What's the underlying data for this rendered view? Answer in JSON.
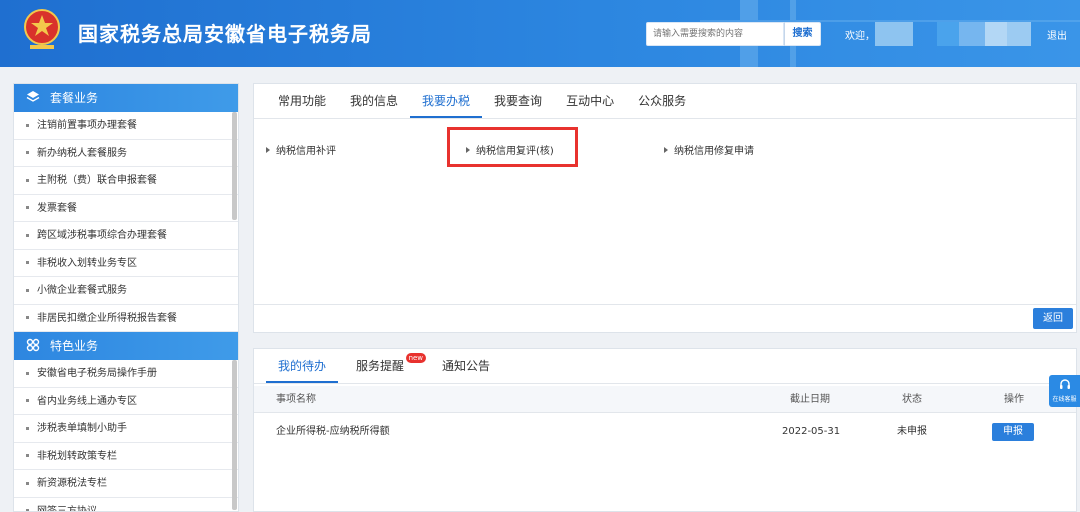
{
  "header": {
    "site_title": "国家税务总局安徽省电子税务局",
    "emblem_caption": "中国税务",
    "search_placeholder": "请输入需要搜索的内容",
    "search_button": "搜索",
    "welcome": "欢迎，",
    "logout": "退出",
    "colors": {
      "bar": "#1f6fd0",
      "accent": "#2b7fdc",
      "highlight": "#e8322e"
    }
  },
  "sidebar": {
    "section1": {
      "title": "套餐业务",
      "icon": "layers-icon",
      "items": [
        "注销前置事项办理套餐",
        "新办纳税人套餐服务",
        "主附税（费）联合申报套餐",
        "发票套餐",
        "跨区域涉税事项综合办理套餐",
        "非税收入划转业务专区",
        "小微企业套餐式服务",
        "非居民扣缴企业所得税报告套餐"
      ]
    },
    "section2": {
      "title": "特色业务",
      "icon": "grid-icon",
      "items": [
        "安徽省电子税务局操作手册",
        "省内业务线上通办专区",
        "涉税表单填制小助手",
        "非税划转政策专栏",
        "新资源税法专栏",
        "网签三方协议"
      ]
    }
  },
  "top_panel": {
    "tabs": [
      "常用功能",
      "我的信息",
      "我要办税",
      "我要查询",
      "互动中心",
      "公众服务"
    ],
    "active_tab": 2,
    "links": [
      "纳税信用补评",
      "纳税信用复评(核)",
      "纳税信用修复申请"
    ],
    "back_button": "返回"
  },
  "bottom_panel": {
    "tabs": [
      "我的待办",
      "服务提醒",
      "通知公告"
    ],
    "new_badge": "new",
    "columns": [
      "事项名称",
      "截止日期",
      "状态",
      "操作"
    ],
    "rows": [
      {
        "name": "企业所得税-应纳税所得额",
        "deadline": "2022-05-31",
        "status": "未申报",
        "action": "申报"
      }
    ]
  },
  "float_service": {
    "label": "在线客服",
    "icon": "headset-icon"
  }
}
